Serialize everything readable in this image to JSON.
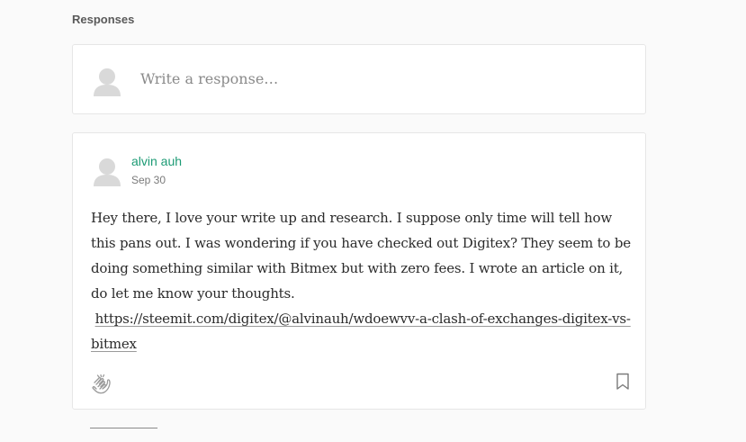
{
  "responses": {
    "heading": "Responses",
    "compose": {
      "placeholder": "Write a response…",
      "avatar_icon": "user-placeholder-icon"
    },
    "items": [
      {
        "author": "alvin auh",
        "date": "Sep 30",
        "body": "Hey there, I love your write up and research. I suppose only time will tell how this pans out. I was wondering if you have checked out Digitex? They seem to be doing something similar with Bitmex but with zero fees. I wrote an article on it, do let me know your thoughts.",
        "link": "https://steemit.com/digitex/@alvinauh/wdoewvv-a-clash-of-exchanges-digitex-vs-bitmex",
        "actions": {
          "clap_icon": "clap-icon",
          "bookmark_icon": "bookmark-icon"
        }
      }
    ]
  },
  "colors": {
    "author": "#1d9b75",
    "background": "#fafafa",
    "card_border": "#e6e6e6"
  }
}
